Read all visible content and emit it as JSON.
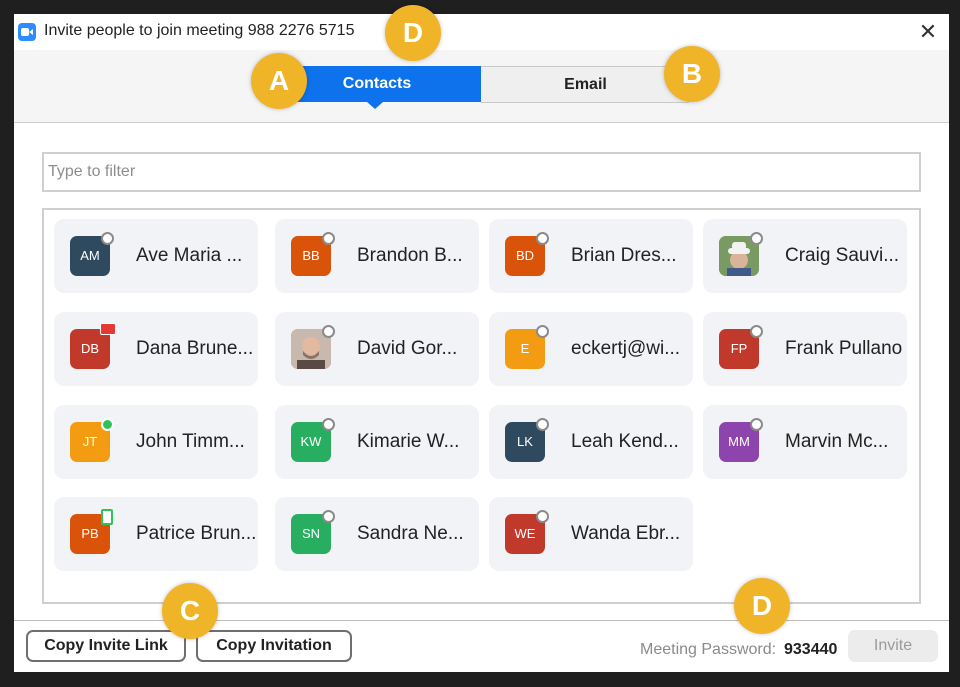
{
  "window": {
    "title": "Invite people to join meeting 988 2276 5715",
    "close_glyph": "✕"
  },
  "tabs": [
    {
      "label": "Contacts",
      "active": true
    },
    {
      "label": "Email",
      "active": false
    }
  ],
  "filter": {
    "placeholder": "Type to filter",
    "value": ""
  },
  "contacts": [
    {
      "initials": "AM",
      "name": "Ave Maria ...",
      "color": "#2f4a5e",
      "status": "offline"
    },
    {
      "initials": "BB",
      "name": "Brandon B...",
      "color": "#d9530a",
      "status": "offline"
    },
    {
      "initials": "BD",
      "name": "Brian Dres...",
      "color": "#d9530a",
      "status": "offline"
    },
    {
      "initials": "",
      "name": "Craig Sauvi...",
      "color": "#6f8f5a",
      "status": "offline",
      "photo": "man-in-hat-photo"
    },
    {
      "initials": "DB",
      "name": "Dana Brune...",
      "color": "#c0392b",
      "status": "in-meeting"
    },
    {
      "initials": "",
      "name": "David Gor...",
      "color": "#b98f7a",
      "status": "offline",
      "photo": "bald-man-photo"
    },
    {
      "initials": "E",
      "name": "eckertj@wi...",
      "color": "#f39c12",
      "status": "offline"
    },
    {
      "initials": "FP",
      "name": "Frank Pullano",
      "color": "#c0392b",
      "status": "offline"
    },
    {
      "initials": "JT",
      "name": "John Timm...",
      "color": "#f39c12",
      "status": "online"
    },
    {
      "initials": "KW",
      "name": "Kimarie W...",
      "color": "#27ae60",
      "status": "offline"
    },
    {
      "initials": "LK",
      "name": "Leah Kend...",
      "color": "#2f4a5e",
      "status": "offline"
    },
    {
      "initials": "MM",
      "name": "Marvin Mc...",
      "color": "#8e44ad",
      "status": "offline"
    },
    {
      "initials": "PB",
      "name": "Patrice Brun...",
      "color": "#d9530a",
      "status": "mobile"
    },
    {
      "initials": "SN",
      "name": "Sandra Ne...",
      "color": "#27ae60",
      "status": "offline"
    },
    {
      "initials": "WE",
      "name": "Wanda Ebr...",
      "color": "#c0392b",
      "status": "offline"
    }
  ],
  "footer": {
    "copy_link_label": "Copy Invite Link",
    "copy_invitation_label": "Copy Invitation",
    "password_label": "Meeting Password:",
    "password_value": "933440",
    "invite_label": "Invite"
  },
  "callouts": {
    "a": "A",
    "b": "B",
    "c": "C",
    "d_title": "D",
    "d_password": "D"
  },
  "colors": {
    "accent": "#0e72ed",
    "callout": "#f0b429",
    "background": "#1f1f1f"
  }
}
